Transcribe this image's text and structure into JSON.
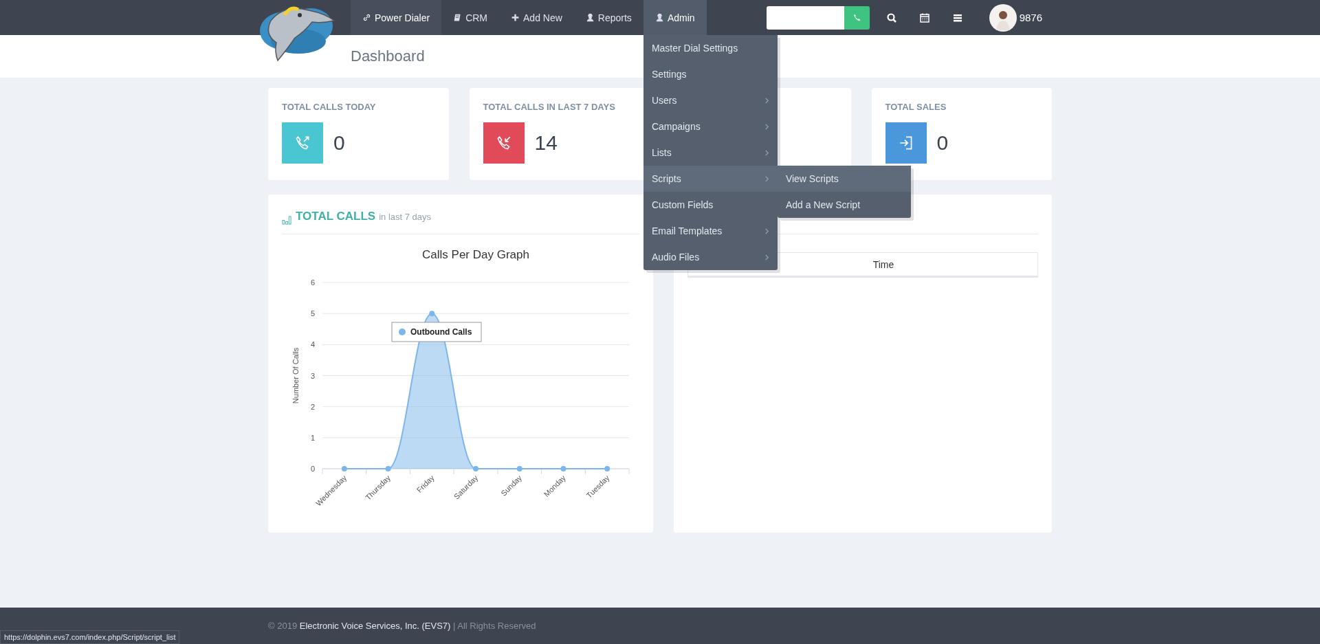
{
  "nav": {
    "items": [
      {
        "label": "Power Dialer",
        "selected": false
      },
      {
        "label": "CRM",
        "selected": false
      },
      {
        "label": "Add New",
        "selected": false
      },
      {
        "label": "Reports",
        "selected": false
      },
      {
        "label": "Admin",
        "selected": true
      }
    ],
    "user": {
      "name": "9876"
    }
  },
  "admin_menu": [
    {
      "label": "Master Dial Settings",
      "submenu": false,
      "selected": false
    },
    {
      "label": "Settings",
      "submenu": false,
      "selected": false
    },
    {
      "label": "Users",
      "submenu": true,
      "selected": false
    },
    {
      "label": "Campaigns",
      "submenu": true,
      "selected": false
    },
    {
      "label": "Lists",
      "submenu": true,
      "selected": false
    },
    {
      "label": "Scripts",
      "submenu": true,
      "selected": true,
      "children": [
        {
          "label": "View Scripts",
          "selected": true
        },
        {
          "label": "Add a New Script",
          "selected": false
        }
      ]
    },
    {
      "label": "Custom Fields",
      "submenu": false,
      "selected": false
    },
    {
      "label": "Email Templates",
      "submenu": true,
      "selected": false
    },
    {
      "label": "Audio Files",
      "submenu": true,
      "selected": false
    }
  ],
  "page": {
    "title": "Dashboard"
  },
  "stats": [
    {
      "title": "TOTAL CALLS TODAY",
      "value": "0",
      "kind": "outgoing",
      "color": "#4ac6d2"
    },
    {
      "title": "TOTAL CALLS IN LAST 7 DAYS",
      "value": "14",
      "kind": "incoming",
      "color": "#e14b59"
    },
    {
      "kind": "hidden"
    },
    {
      "title": "TOTAL SALES",
      "value": "0",
      "kind": "sales",
      "color": "#4a97dc"
    }
  ],
  "calls_panel": {
    "title": "TOTAL CALLS",
    "subtitle": "in last 7 days",
    "chart_data": {
      "type": "area",
      "title": "Calls Per Day Graph",
      "ylabel": "Number Of Calls",
      "categories": [
        "Wednesday",
        "Thursday",
        "Friday",
        "Saturday",
        "Sunday",
        "Monday",
        "Tuesday"
      ],
      "series": [
        {
          "name": "Outbound Calls",
          "color": "#7cb5ec",
          "values": [
            0,
            0,
            5,
            0,
            0,
            0,
            0
          ]
        }
      ],
      "ylim": [
        0,
        6
      ],
      "yticks": [
        0,
        1,
        2,
        3,
        4,
        5,
        6
      ],
      "grid": true
    }
  },
  "right_panel": {
    "table": {
      "columns": [
        "Time"
      ]
    }
  },
  "footer": {
    "copyright": "© 2019",
    "company": "Electronic Voice Services, Inc. (EVS7)",
    "rights": "| All Rights Reserved"
  },
  "status_bar": {
    "url": "https://dolphin.evs7.com/index.php/Script/script_list"
  }
}
